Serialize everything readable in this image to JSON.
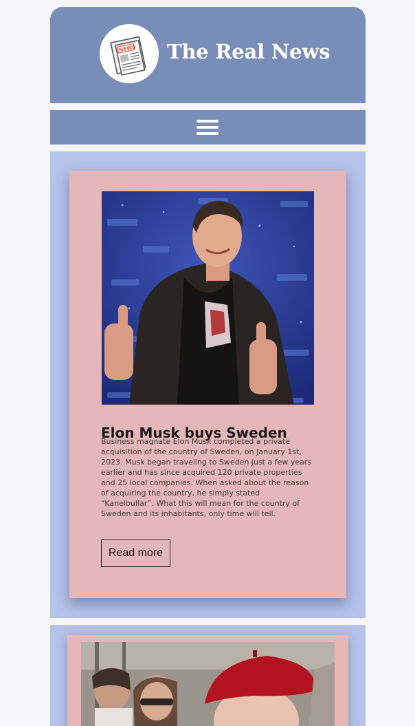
{
  "header": {
    "site_title": "The Real News",
    "logo_icon": "newspaper-icon",
    "logo_badge_text": "NEWS"
  },
  "nav": {
    "menu_icon": "hamburger-menu-icon"
  },
  "articles": [
    {
      "image": "photo-man-thumbs-up",
      "title": "Elon Musk buys Sweden",
      "body": "Business magnate Elon Musk completed a private acquisition of the country of Sweden, on January 1st, 2023. Musk began traveling to Sweden just a few years earlier and has since acquired 120 private properties and 25 local companies. When asked about the reason of acquiring the country, he simply stated “Kanelbullar”. What this will mean for the country of Sweden and its inhabitants, only time will tell.",
      "read_more": "Read more"
    },
    {
      "image": "photo-woman-red-beret"
    }
  ],
  "colors": {
    "header_bg": "#788db7",
    "section_bg": "#b5c2ea",
    "card_bg": "#e6b7b8",
    "page_bg": "#f6f6f8"
  }
}
